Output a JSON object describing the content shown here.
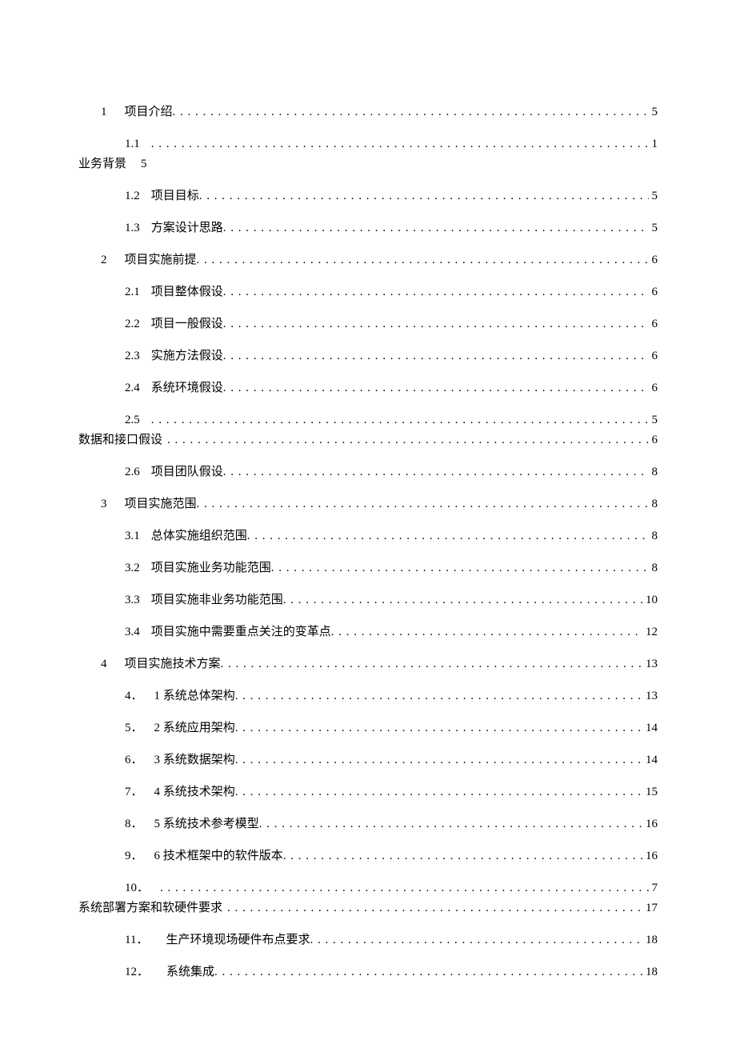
{
  "dots": ". . . . . . . . . . . . . . . . . . . . . . . . . . . . . . . . . . . . . . . . . . . . . . . . . . . . . . . . . . . . . . . . . . . . . . . . . . . . . . . . . . . . . . . . . . . . . . . . . . . . . . . . . . . . . . . . . . . . . . . . . . . . . . . . . . . . . . . . . . . . . . . . . . . . . . . . .",
  "toc": [
    {
      "type": "l1",
      "num": "1",
      "title": "项目介绍",
      "page": "5"
    },
    {
      "type": "l2wrap",
      "num": "1.1",
      "wrap_label": "业务背景",
      "wrap_page": "5",
      "tail_page": "1"
    },
    {
      "type": "l2",
      "num": "1.2",
      "title": "项目目标",
      "page": "5"
    },
    {
      "type": "l2",
      "num": "1.3",
      "title": "方案设计思路",
      "page": "5"
    },
    {
      "type": "l1",
      "num": "2",
      "title": "项目实施前提",
      "page": "6"
    },
    {
      "type": "l2",
      "num": "2.1",
      "title": "项目整体假设",
      "page": "6"
    },
    {
      "type": "l2",
      "num": "2.2",
      "title": "项目一般假设",
      "page": "6"
    },
    {
      "type": "l2",
      "num": "2.3",
      "title": "实施方法假设",
      "page": "6"
    },
    {
      "type": "l2",
      "num": "2.4",
      "title": "系统环境假设",
      "page": "6"
    },
    {
      "type": "l2wrap2",
      "num": "2.5",
      "tail_page": "5",
      "wrap_label": "数据和接口假设",
      "wrap_page": "6"
    },
    {
      "type": "l2",
      "num": "2.6",
      "title": "项目团队假设",
      "page": "8"
    },
    {
      "type": "l1",
      "num": "3",
      "title": "项目实施范围",
      "page": "8"
    },
    {
      "type": "l2",
      "num": "3.1",
      "title": "总体实施组织范围",
      "page": "8"
    },
    {
      "type": "l2",
      "num": "3.2",
      "title": "项目实施业务功能范围",
      "page": "8"
    },
    {
      "type": "l2",
      "num": "3.3",
      "title": "项目实施非业务功能范围",
      "page": "10"
    },
    {
      "type": "l2",
      "num": "3.4",
      "title": "项目实施中需要重点关注的变革点",
      "page": "12"
    },
    {
      "type": "l1",
      "num": "4",
      "title": "项目实施技术方案",
      "page": "13"
    },
    {
      "type": "l2b",
      "num": "4．",
      "title": "1 系统总体架构",
      "page": "13"
    },
    {
      "type": "l2b",
      "num": "5．",
      "title": "2 系统应用架构",
      "page": "14"
    },
    {
      "type": "l2b",
      "num": "6．",
      "title": "3 系统数据架构",
      "page": "14"
    },
    {
      "type": "l2b",
      "num": "7．",
      "title": "4 系统技术架构",
      "page": "15"
    },
    {
      "type": "l2b",
      "num": "8．",
      "title": "5 系统技术参考模型",
      "page": "16"
    },
    {
      "type": "l2b",
      "num": "9．",
      "title": "6 技术框架中的软件版本",
      "page": "16"
    },
    {
      "type": "l2wrap2",
      "num": "10．",
      "tail_page": "7",
      "wrap_label": "系统部署方案和软硬件要求",
      "wrap_page": "17"
    },
    {
      "type": "l2c",
      "num": "11．",
      "title": "生产环境现场硬件布点要求",
      "page": "18"
    },
    {
      "type": "l2c",
      "num": "12．",
      "title": "系统集成",
      "page": "18"
    }
  ]
}
